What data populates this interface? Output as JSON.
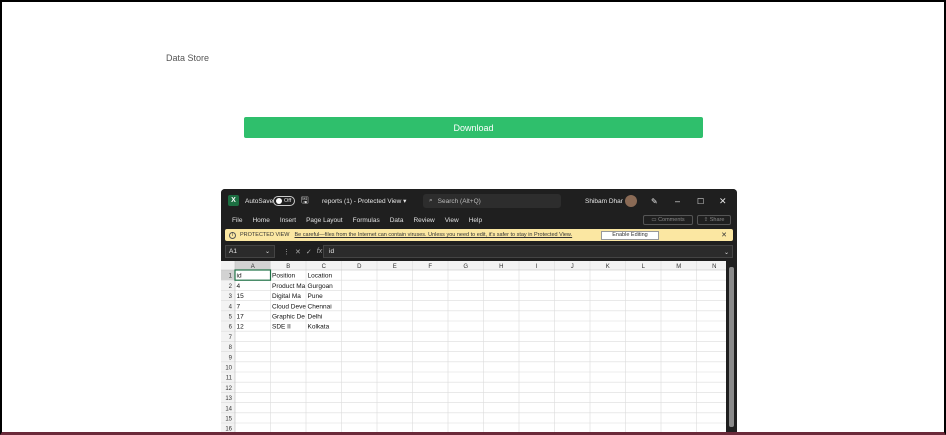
{
  "page": {
    "label": "Data Store",
    "download_label": "Download"
  },
  "excel": {
    "autosave_label": "AutoSave",
    "autosave_state": "Off",
    "doc_title": "reports (1)  -  Protected View  ▾",
    "search_placeholder": "Search (Alt+Q)",
    "user_name": "Shibam Dhar",
    "ribbon_tabs": [
      "File",
      "Home",
      "Insert",
      "Page Layout",
      "Formulas",
      "Data",
      "Review",
      "View",
      "Help"
    ],
    "comments_label": "Comments",
    "share_label": "Share",
    "protected_view": {
      "title": "PROTECTED VIEW",
      "message": "Be careful—files from the Internet can contain viruses. Unless you need to edit, it's safer to stay in Protected View.",
      "enable_label": "Enable Editing"
    },
    "name_box": "A1",
    "formula_value": "id",
    "columns": [
      "A",
      "B",
      "C",
      "D",
      "E",
      "F",
      "G",
      "H",
      "I",
      "J",
      "K",
      "L",
      "M",
      "N"
    ],
    "row_numbers": [
      "1",
      "2",
      "3",
      "4",
      "5",
      "6",
      "7",
      "8",
      "9",
      "10",
      "11",
      "12",
      "13",
      "14",
      "15",
      "16"
    ],
    "cells": [
      [
        "id",
        "Position",
        "Location"
      ],
      [
        "4",
        "Product Ma",
        "Gurgoan"
      ],
      [
        "15",
        "Digital Ma",
        "Pune"
      ],
      [
        "7",
        "Cloud Deve",
        "Chennai"
      ],
      [
        "17",
        "Graphic De",
        "Delhi"
      ],
      [
        "12",
        "SDE II",
        "Kolkata"
      ]
    ]
  }
}
